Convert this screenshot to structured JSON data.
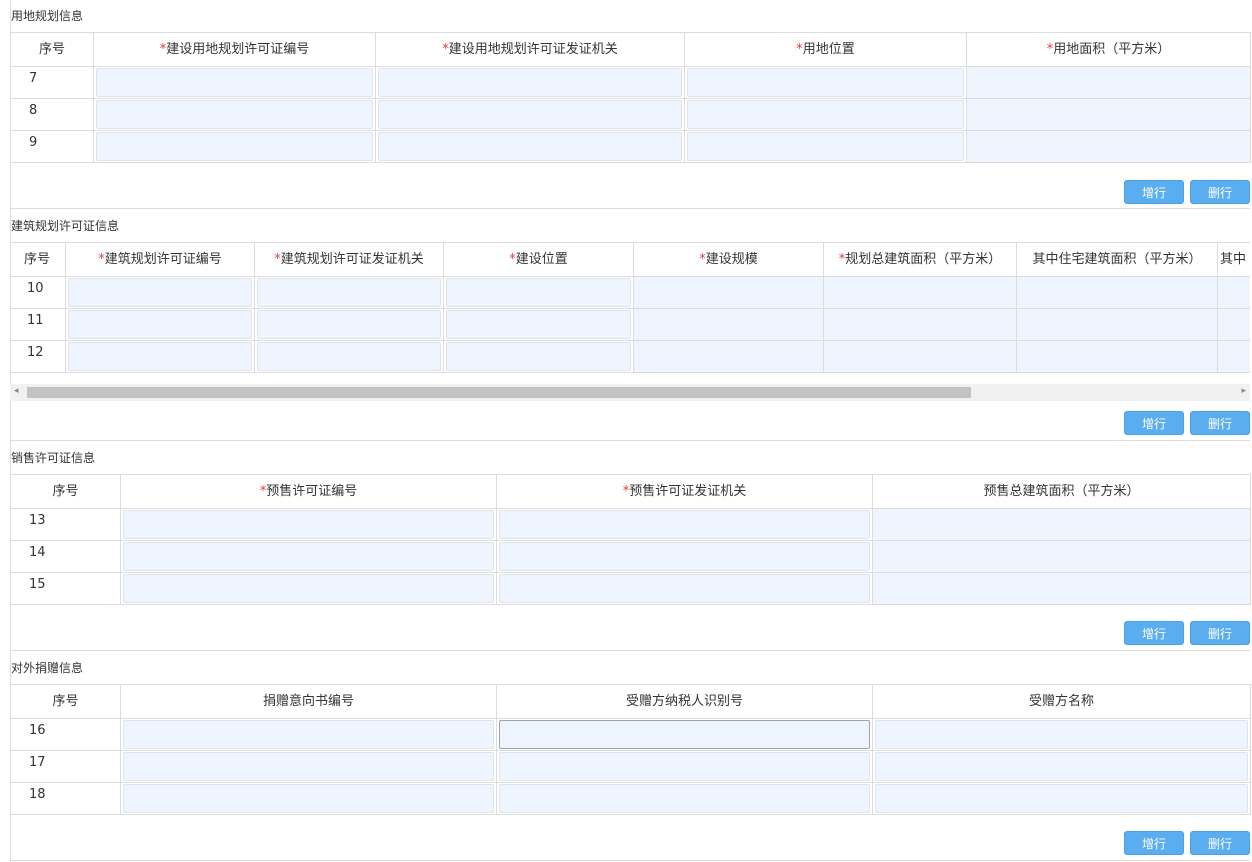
{
  "buttons": {
    "add_row": "增行",
    "del_row": "删行"
  },
  "land": {
    "title": "用地规划信息",
    "columns": [
      {
        "label": "序号",
        "required": false
      },
      {
        "label": "建设用地规划许可证编号",
        "required": true
      },
      {
        "label": "建设用地规划许可证发证机关",
        "required": true
      },
      {
        "label": "用地位置",
        "required": true
      },
      {
        "label": "用地面积（平方米）",
        "required": true
      }
    ],
    "rows": [
      {
        "seq": "7"
      },
      {
        "seq": "8"
      },
      {
        "seq": "9"
      }
    ]
  },
  "building": {
    "title": "建筑规划许可证信息",
    "columns": [
      {
        "label": "序号",
        "required": false
      },
      {
        "label": "建筑规划许可证编号",
        "required": true
      },
      {
        "label": "建筑规划许可证发证机关",
        "required": true
      },
      {
        "label": "建设位置",
        "required": true
      },
      {
        "label": "建设规模",
        "required": true
      },
      {
        "label": "规划总建筑面积（平方米）",
        "required": true
      },
      {
        "label": "其中住宅建筑面积（平方米）",
        "required": false
      },
      {
        "label": "其中",
        "required": false
      }
    ],
    "rows": [
      {
        "seq": "10"
      },
      {
        "seq": "11"
      },
      {
        "seq": "12"
      }
    ],
    "scrollbar": {
      "left_arrow": "◂",
      "right_arrow": "▸"
    }
  },
  "sales": {
    "title": "销售许可证信息",
    "columns": [
      {
        "label": "序号",
        "required": false
      },
      {
        "label": "预售许可证编号",
        "required": true
      },
      {
        "label": "预售许可证发证机关",
        "required": true
      },
      {
        "label": "预售总建筑面积（平方米）",
        "required": false
      }
    ],
    "rows": [
      {
        "seq": "13"
      },
      {
        "seq": "14"
      },
      {
        "seq": "15"
      }
    ]
  },
  "donation": {
    "title": "对外捐赠信息",
    "columns": [
      {
        "label": "序号",
        "required": false
      },
      {
        "label": "捐赠意向书编号",
        "required": false
      },
      {
        "label": "受赠方纳税人识别号",
        "required": false
      },
      {
        "label": "受赠方名称",
        "required": false
      }
    ],
    "rows": [
      {
        "seq": "16"
      },
      {
        "seq": "17"
      },
      {
        "seq": "18"
      }
    ]
  }
}
